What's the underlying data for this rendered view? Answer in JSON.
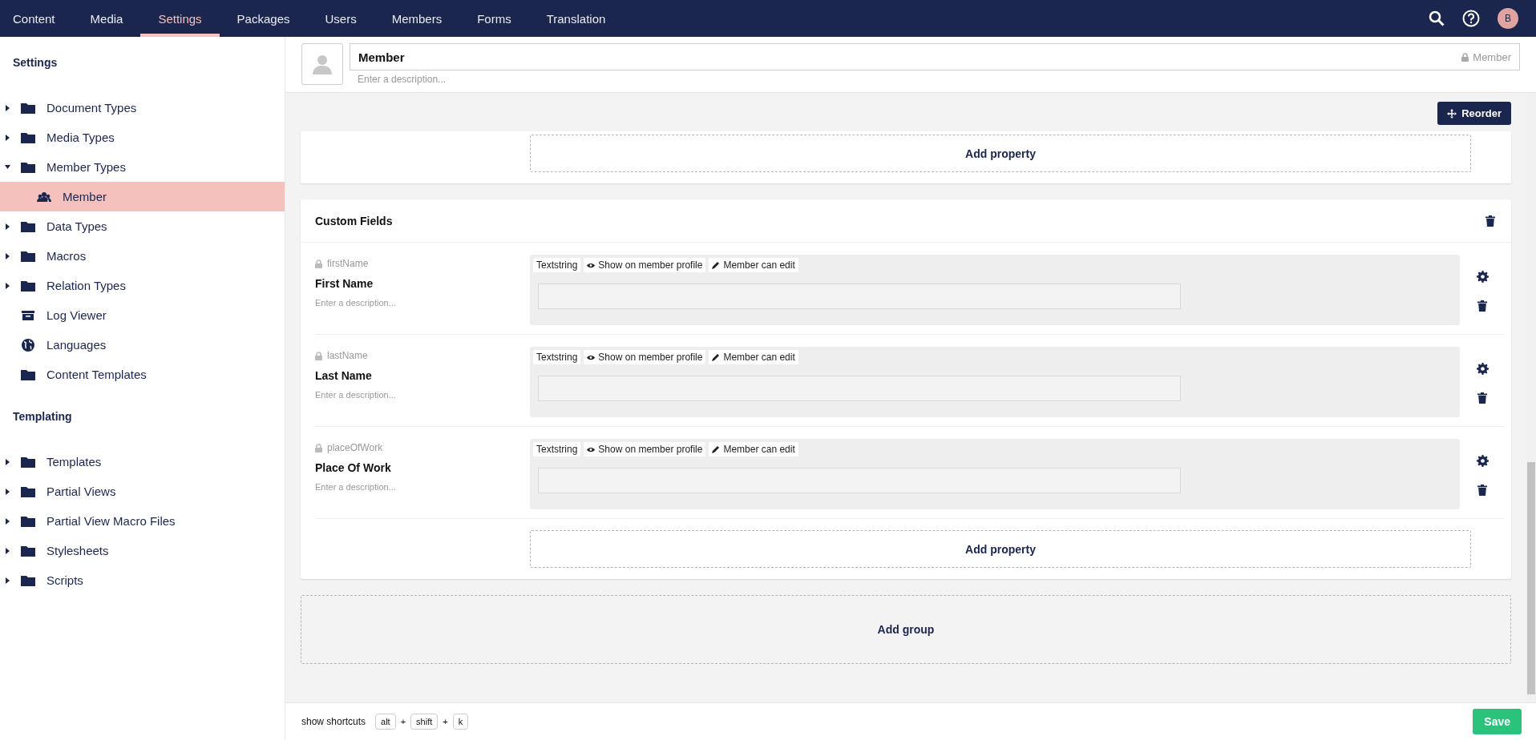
{
  "top_nav": {
    "sections": [
      {
        "label": "Content",
        "selected": false
      },
      {
        "label": "Media",
        "selected": false
      },
      {
        "label": "Settings",
        "selected": true
      },
      {
        "label": "Packages",
        "selected": false
      },
      {
        "label": "Users",
        "selected": false
      },
      {
        "label": "Members",
        "selected": false
      },
      {
        "label": "Forms",
        "selected": false
      },
      {
        "label": "Translation",
        "selected": false
      }
    ],
    "avatar_initial": "B"
  },
  "sidebar": {
    "groups": [
      {
        "title": "Settings",
        "items": [
          {
            "label": "Document Types",
            "kind": "folder",
            "has_children": true,
            "expanded": false,
            "selected": false
          },
          {
            "label": "Media Types",
            "kind": "folder",
            "has_children": true,
            "expanded": false,
            "selected": false
          },
          {
            "label": "Member Types",
            "kind": "folder",
            "has_children": true,
            "expanded": true,
            "selected": false,
            "children": [
              {
                "label": "Member",
                "kind": "member",
                "has_children": false,
                "selected": true
              }
            ]
          },
          {
            "label": "Data Types",
            "kind": "folder",
            "has_children": true,
            "expanded": false,
            "selected": false
          },
          {
            "label": "Macros",
            "kind": "folder",
            "has_children": true,
            "expanded": false,
            "selected": false
          },
          {
            "label": "Relation Types",
            "kind": "folder",
            "has_children": true,
            "expanded": false,
            "selected": false
          },
          {
            "label": "Log Viewer",
            "kind": "log",
            "has_children": false,
            "selected": false
          },
          {
            "label": "Languages",
            "kind": "language",
            "has_children": false,
            "selected": false
          },
          {
            "label": "Content Templates",
            "kind": "folder",
            "has_children": false,
            "selected": false
          }
        ]
      },
      {
        "title": "Templating",
        "items": [
          {
            "label": "Templates",
            "kind": "folder",
            "has_children": true,
            "expanded": false,
            "selected": false
          },
          {
            "label": "Partial Views",
            "kind": "folder",
            "has_children": true,
            "expanded": false,
            "selected": false
          },
          {
            "label": "Partial View Macro Files",
            "kind": "folder",
            "has_children": true,
            "expanded": false,
            "selected": false
          },
          {
            "label": "Stylesheets",
            "kind": "folder",
            "has_children": true,
            "expanded": false,
            "selected": false
          },
          {
            "label": "Scripts",
            "kind": "folder",
            "has_children": true,
            "expanded": false,
            "selected": false
          }
        ]
      }
    ]
  },
  "header": {
    "name": "Member",
    "alias": "Member",
    "description_placeholder": "Enter a description..."
  },
  "toolbar": {
    "reorder_button": "Reorder"
  },
  "upper_group": {
    "add_property": "Add property"
  },
  "group": {
    "title": "Custom Fields",
    "add_property": "Add property",
    "properties": [
      {
        "alias": "firstName",
        "name": "First Name",
        "description_placeholder": "Enter a description...",
        "tags": [
          "Textstring",
          "Show on member profile",
          "Member can edit"
        ]
      },
      {
        "alias": "lastName",
        "name": "Last Name",
        "description_placeholder": "Enter a description...",
        "tags": [
          "Textstring",
          "Show on member profile",
          "Member can edit"
        ]
      },
      {
        "alias": "placeOfWork",
        "name": "Place Of Work",
        "description_placeholder": "Enter a description...",
        "tags": [
          "Textstring",
          "Show on member profile",
          "Member can edit"
        ]
      }
    ]
  },
  "add_group": "Add group",
  "footer": {
    "shortcuts_label": "show shortcuts",
    "keys": [
      "alt",
      "shift",
      "k"
    ],
    "separators": [
      "+",
      "+"
    ],
    "save_button": "Save"
  }
}
